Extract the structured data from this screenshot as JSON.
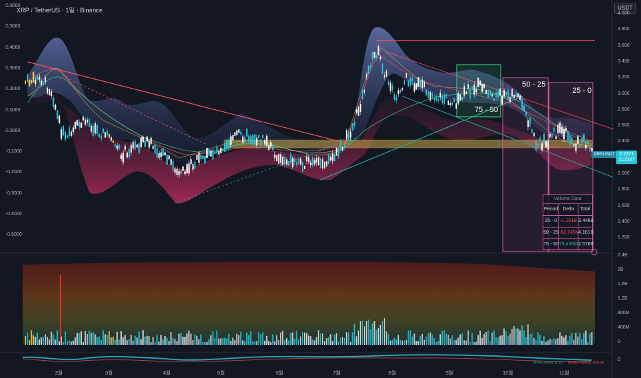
{
  "header": {
    "title": "XRP / TetherUS · 1일 · Binance",
    "currency_button": "USDT"
  },
  "left_axis": [
    "0.6000",
    "0.5000",
    "0.4000",
    "0.3000",
    "0.2000",
    "0.1000",
    "0.0000",
    "-0.1000",
    "-0.2000",
    "-0.3000",
    "-0.4000",
    "-0.5000"
  ],
  "right_axis": [
    "4.000",
    "3.800",
    "3.600",
    "3.400",
    "3.200",
    "3.000",
    "2.800",
    "2.600",
    "2.400",
    "2.200",
    "2.000",
    "1.800",
    "1.600",
    "1.400",
    "1.200"
  ],
  "volume_axis": [
    "2.4B",
    "2B",
    "1.6B",
    "1.2B",
    "800M",
    "400M",
    "0"
  ],
  "oscillator_axis": [
    "0"
  ],
  "months": [
    "2월",
    "3월",
    "4월",
    "5월",
    "6월",
    "7월",
    "8월",
    "9월",
    "10월",
    "11월"
  ],
  "boxes": {
    "b75": "75 - 50",
    "b50": "50 - 25",
    "b25": "25 - 0"
  },
  "price_tag": {
    "symbol": "XRPUSDT",
    "price": "2.2371",
    "countdown": "21:23:07"
  },
  "volume_table": {
    "title": "Volume Data",
    "headers": [
      "Period",
      "Delta",
      "Total"
    ],
    "rows": [
      {
        "period": "25 - 0",
        "delta": "-1.161B",
        "total": "3.446B",
        "color": "#ef5350"
      },
      {
        "period": "50 - 25",
        "delta": "-62.745M",
        "total": "4.161B",
        "color": "#ef5350"
      },
      {
        "period": "75 - 50",
        "delta": "78.438M",
        "total": "2.576B",
        "color": "#26a69a"
      }
    ]
  },
  "osc_legend": {
    "inflow": "Money Inflow 12.67",
    "outflow": "Money Outflow -536.39"
  },
  "colors": {
    "background": "#131722",
    "up": "#26c6da",
    "down": "#ffffff",
    "highlight": "#f5d547",
    "box": "#d0579d",
    "green_box": "#3ddc84"
  }
}
